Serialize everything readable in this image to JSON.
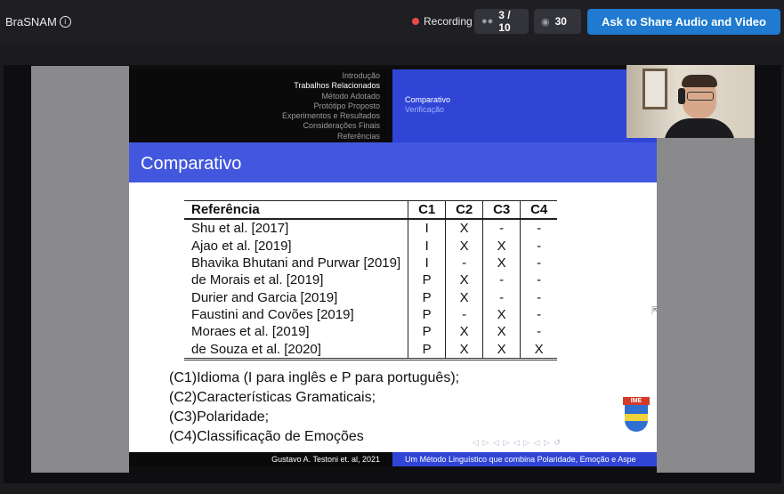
{
  "app": {
    "name": "BraSNAM"
  },
  "topbar": {
    "recording_label": "Recording",
    "participants_count": "3 / 10",
    "viewers_count": "30",
    "share_button_label": "Ask to Share Audio and Video"
  },
  "slide": {
    "nav_sections": [
      "Introdução",
      "Trabalhos Relacionados",
      "Método Adotado",
      "Protótipo Proposto",
      "Experimentos e Resultados",
      "Considerações Finais",
      "Referências"
    ],
    "nav_active_index": 1,
    "current_section": "Comparativo",
    "current_subsection": "Verificação",
    "title": "Comparativo",
    "table": {
      "headers": [
        "Referência",
        "C1",
        "C2",
        "C3",
        "C4"
      ],
      "rows": [
        [
          "Shu et al. [2017]",
          "I",
          "X",
          "-",
          "-"
        ],
        [
          "Ajao et al. [2019]",
          "I",
          "X",
          "X",
          "-"
        ],
        [
          "Bhavika Bhutani and Purwar [2019]",
          "I",
          "-",
          "X",
          "-"
        ],
        [
          "de Morais et al. [2019]",
          "P",
          "X",
          "-",
          "-"
        ],
        [
          "Durier and Garcia [2019]",
          "P",
          "X",
          "-",
          "-"
        ],
        [
          "Faustini and Covões [2019]",
          "P",
          "-",
          "X",
          "-"
        ],
        [
          "Moraes et al. [2019]",
          "P",
          "X",
          "X",
          "-"
        ],
        [
          "de Souza et al. [2020]",
          "P",
          "X",
          "X",
          "X"
        ]
      ]
    },
    "legend": [
      "(C1)Idioma (I para inglês e P para português);",
      "(C2)Características Gramaticais;",
      "(C3)Polaridade;",
      "(C4)Classificação de Emoções"
    ],
    "logo_text": "IME",
    "footer_left": "Gustavo A. Testoni et. al, 2021",
    "footer_right": "Um Método Linguístico que combina Polaridade, Emoção e Aspe"
  },
  "colors": {
    "accent": "#1f7ad0",
    "slide_blue": "#3045d6",
    "record_dot": "#e84a4a"
  }
}
